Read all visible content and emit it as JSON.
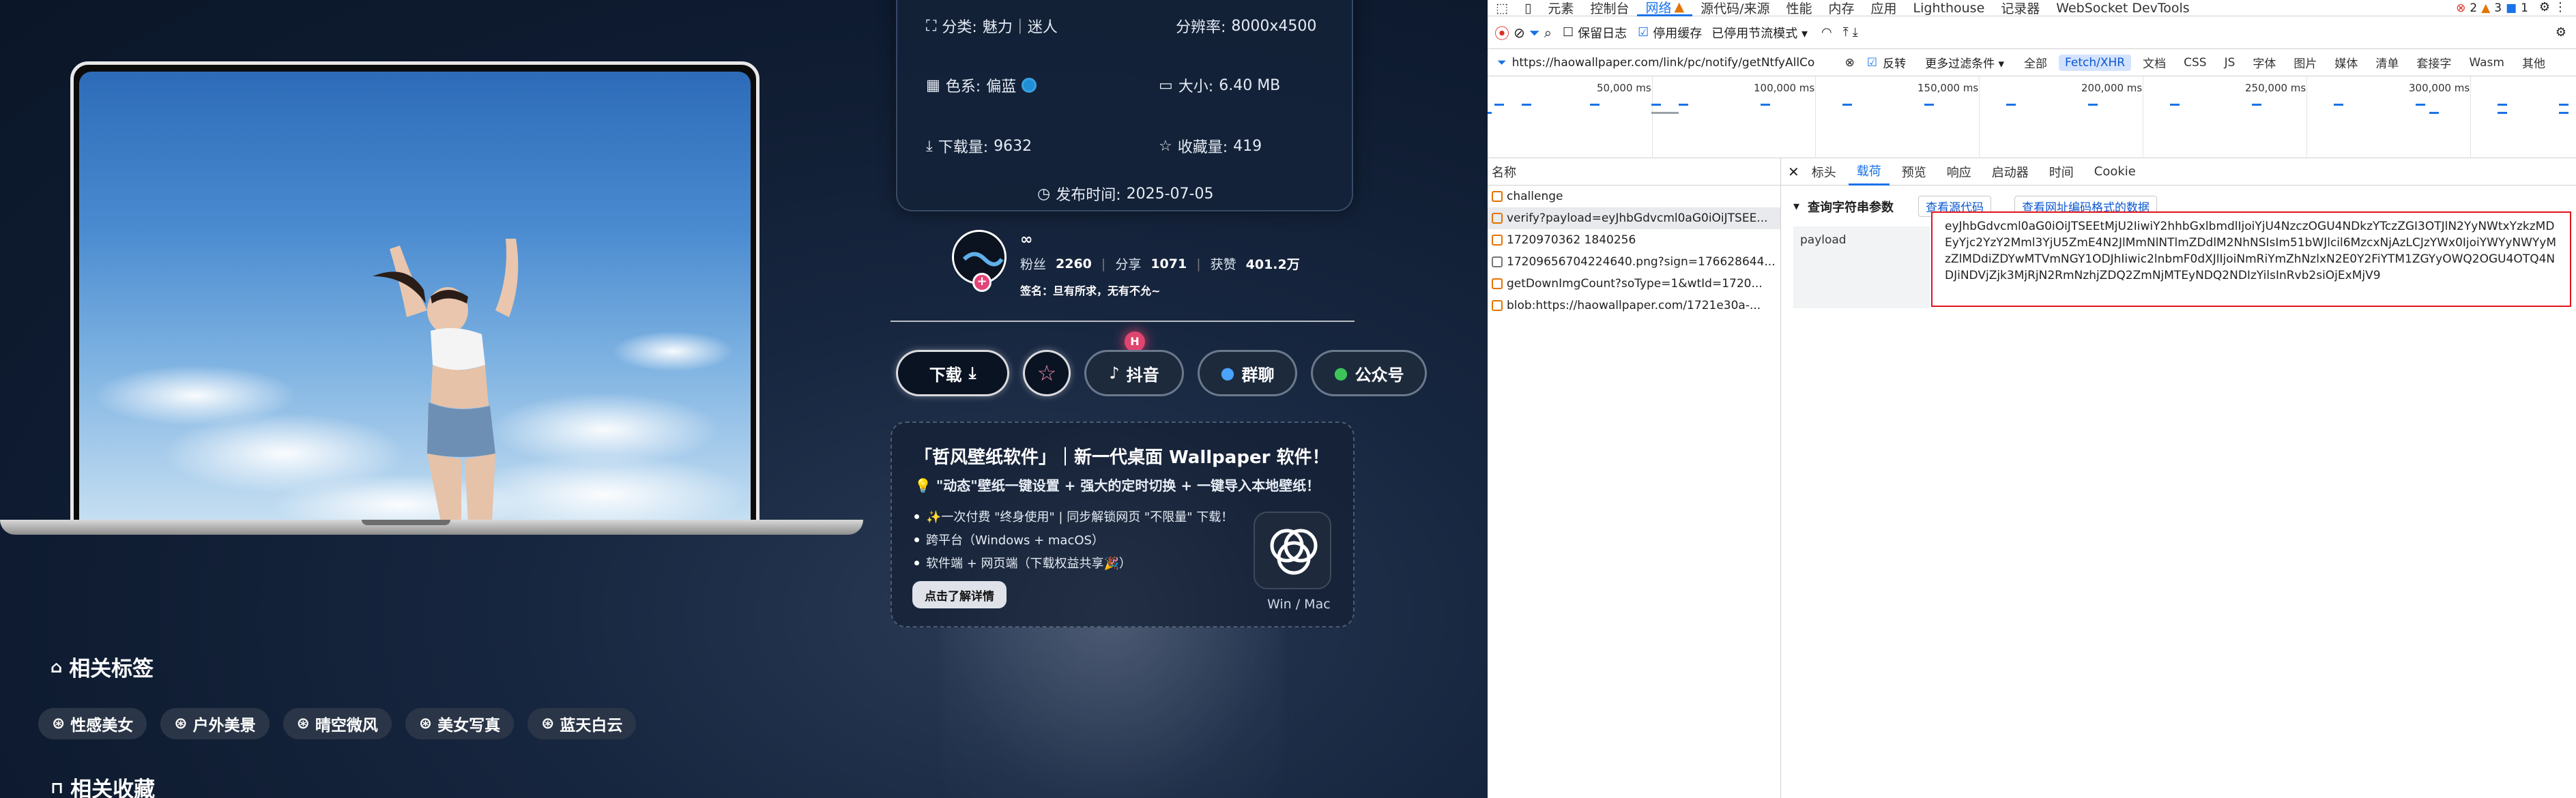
{
  "info": {
    "category_label": "分类:",
    "category_value": "魅力｜迷人",
    "resolution_label": "分辨率:",
    "resolution_value": "8000x4500",
    "color_label": "色系:",
    "color_value": "偏蓝",
    "size_label": "大小:",
    "size_value": "6.40 MB",
    "downloads_label": "下载量:",
    "downloads_value": "9632",
    "favorites_label": "收藏量:",
    "favorites_value": "419",
    "published_label": "发布时间:",
    "published_value": "2025-07-05",
    "swatch_color": "#1f8fd6"
  },
  "profile": {
    "name": "∞",
    "fans_label": "粉丝",
    "fans_value": "2260",
    "shares_label": "分享",
    "shares_value": "1071",
    "likes_label": "获赞",
    "likes_value": "401.2万",
    "signature": "签名：旦有所求，无有不允~",
    "badge": "+"
  },
  "buttons": {
    "download": "下载",
    "douyin": "抖音",
    "group": "群聊",
    "wechat": "公众号",
    "hot_badge": "H"
  },
  "promo": {
    "title": "「哲风壁纸软件」｜新一代桌面 Wallpaper 软件！",
    "subtitle": "💡 \"动态\"壁纸一键设置 + 强大的定时切换 + 一键导入本地壁纸！",
    "items": [
      "✨一次付费 \"终身使用\" | 同步解锁网页 \"不限量\" 下载！",
      "跨平台（Windows + macOS）",
      "软件端 + 网页端（下载权益共享🎉）"
    ],
    "cta": "点击了解详情",
    "platform": "Win / Mac"
  },
  "sections": {
    "tags_title": "相关标签",
    "collections_title": "相关收藏"
  },
  "tags": [
    "性感美女",
    "户外美景",
    "晴空微风",
    "美女写真",
    "蓝天白云"
  ],
  "devtools": {
    "tabs": [
      "元素",
      "控制台",
      "网络",
      "源代码/来源",
      "性能",
      "内存",
      "应用",
      "Lighthouse",
      "记录器",
      "WebSocket DevTools"
    ],
    "active_tab": "网络",
    "errors": "2",
    "warnings": "3",
    "infos": "1",
    "toolbar": {
      "preserve_log": "保留日志",
      "disable_cache": "停用缓存",
      "throttle": "已停用节流模式"
    },
    "filter": {
      "url": "https://haowallpaper.com/link/pc/notify/getNtfyAllCo",
      "invert": "反转",
      "more_filters": "更多过滤条件",
      "types": [
        "全部",
        "Fetch/XHR",
        "文档",
        "CSS",
        "JS",
        "字体",
        "图片",
        "媒体",
        "清单",
        "套接字",
        "Wasm",
        "其他"
      ],
      "active_type": "Fetch/XHR"
    },
    "timeline_ticks": [
      "50,000 ms",
      "100,000 ms",
      "150,000 ms",
      "200,000 ms",
      "250,000 ms",
      "300,000 ms"
    ],
    "list_header": "名称",
    "requests": [
      {
        "name": "challenge",
        "kind": "xhr"
      },
      {
        "name": "verify?payload=eyJhbGdvcml0aG0iOiJTSEE...",
        "kind": "xhr"
      },
      {
        "name": "1720970362 1840256",
        "kind": "xhr"
      },
      {
        "name": "17209656704224640.png?sign=176628644...",
        "kind": "doc"
      },
      {
        "name": "getDownImgCount?soType=1&wtId=1720...",
        "kind": "xhr"
      },
      {
        "name": "blob:https://haowallpaper.com/1721e30a-...",
        "kind": "xhr"
      }
    ],
    "detail_tabs": [
      "标头",
      "载荷",
      "预览",
      "响应",
      "启动器",
      "时间",
      "Cookie"
    ],
    "active_detail_tab": "载荷",
    "query_title": "查询字符串参数",
    "view_source": "查看源代码",
    "view_decoded": "查看网址编码格式的数据",
    "param_name": "payload",
    "param_value": "eyJhbGdvcml0aG0iOiJTSEEtMjU2IiwiY2hhbGxlbmdlIjoiYjU4NzczOGU4NDkzYTczZGI3OTJlN2YyNWtxYzkzMDEyYjc2YzY2Mml3YjU5ZmE4N2JlMmNlNTlmZDdlM2NhNSIsIm51bWJlcil6MzcxNjAzLCJzYWx0IjoiYWYyNWYyMzZlMDdiZDYwMTVmNGY1ODJhIiwic2lnbmF0dXJlIjoiNmRiYmZhNzlxN2E0Y2FiYTM1ZGYyOWQ2OGU4OTQ4NDJiNDVjZjk3MjRjN2RmNzhjZDQ2ZmNjMTEyNDQ2NDIzYilsInRvb2siOjExMjV9"
  }
}
